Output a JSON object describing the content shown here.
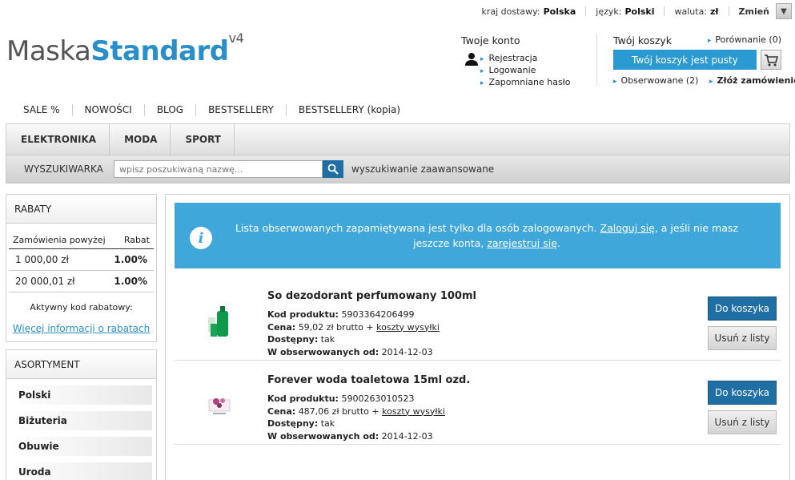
{
  "topbar": {
    "delivery_label": "kraj dostawy:",
    "delivery_value": "Polska",
    "language_label": "język:",
    "language_value": "Polski",
    "currency_label": "waluta:",
    "currency_value": "zł",
    "change_label": "Zmień"
  },
  "logo": {
    "part1": "Maska",
    "part2": "Standard",
    "version": "v4"
  },
  "account": {
    "title": "Twoje konto",
    "links": [
      "Rejestracja",
      "Logowanie",
      "Zapomniane hasło"
    ]
  },
  "cart": {
    "title": "Twój koszyk",
    "compare_label": "Porównanie (0)",
    "button_label": "Twój koszyk jest pusty",
    "observed_label": "Obserwowane (2)",
    "order_label": "Złóż zamówienie"
  },
  "toplinks": [
    "SALE %",
    "NOWOŚCI",
    "BLOG",
    "BESTSELLERY",
    "BESTSELLERY (kopia)"
  ],
  "categories": [
    "ELEKTRONIKA",
    "MODA",
    "SPORT"
  ],
  "search": {
    "label": "WYSZUKIWARKA",
    "placeholder": "wpisz poszukiwaną nazwę...",
    "advanced_label": "wyszukiwanie zaawansowane"
  },
  "rabaty": {
    "title": "RABATY",
    "col_order": "Zamówienia powyżej",
    "col_discount": "Rabat",
    "rows": [
      {
        "amount": "1 000,00 zł",
        "discount": "1.00%"
      },
      {
        "amount": "20 000,01 zł",
        "discount": "1.00%"
      }
    ],
    "code_label": "Aktywny kod rabatowy:",
    "more_link": "Więcej informacji o rabatach"
  },
  "asortyment": {
    "title": "ASORTYMENT",
    "items": [
      "Polski",
      "Biżuteria",
      "Obuwie",
      "Uroda"
    ]
  },
  "info": {
    "text1": "Lista obserwowanych zapamiętywana jest tylko dla osób zalogowanych.",
    "login_link": "Zaloguj się",
    "text2": ", a jeśli nie masz jeszcze konta,",
    "register_link": "zarejestruj się",
    "text3": "."
  },
  "labels": {
    "code": "Kod produktu:",
    "price": "Cena:",
    "available": "Dostępny:",
    "observed_since": "W obserwowanych od:",
    "shipping": "koszty wysyłki",
    "buy": "Do koszyka",
    "remove": "Usuń z listy"
  },
  "products": [
    {
      "name": "So dezodorant perfumowany 100ml",
      "code": "5903364206499",
      "price": "59,02 zł brutto +",
      "available": "tak",
      "observed_since": "2014-12-03"
    },
    {
      "name": "Forever woda toaletowa 15ml ozd.",
      "code": "5900263010523",
      "price": "487,06 zł brutto +",
      "available": "tak",
      "observed_since": "2014-12-03"
    }
  ]
}
